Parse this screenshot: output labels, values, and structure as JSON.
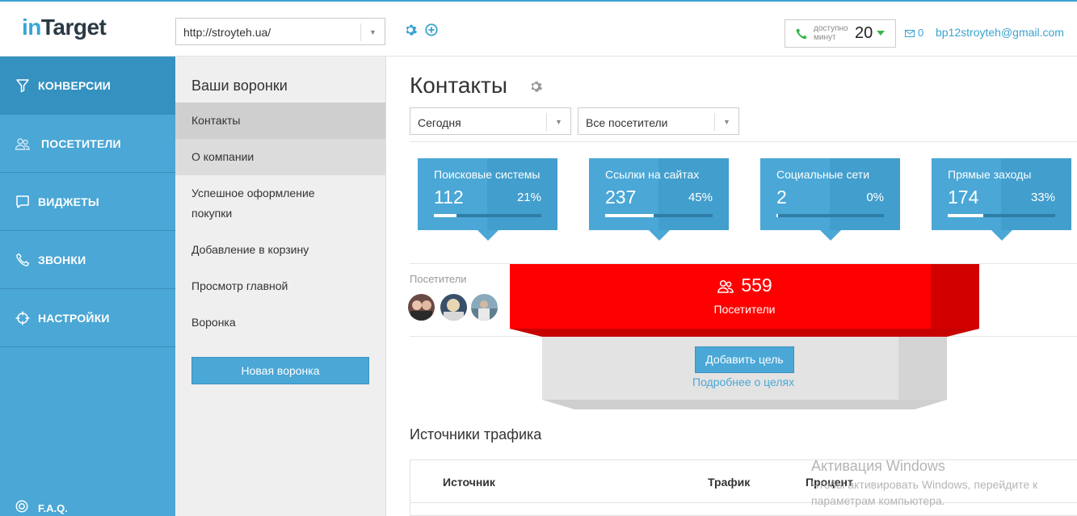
{
  "header": {
    "logo_prefix": "in",
    "logo_suffix": "Target",
    "site_select": "http://stroyteh.ua/",
    "minutes_label_line1": "доступно",
    "minutes_label_line2": "минут",
    "minutes_value": "20",
    "messages_count": "0",
    "email": "bp12stroyteh@gmail.com"
  },
  "sidebar": {
    "items": [
      {
        "label": "КОНВЕРСИИ",
        "icon": "filter-icon"
      },
      {
        "label": "ПОСЕТИТЕЛИ",
        "icon": "users-icon"
      },
      {
        "label": "ВИДЖЕТЫ",
        "icon": "widget-icon"
      },
      {
        "label": "ЗВОНКИ",
        "icon": "phone-icon"
      },
      {
        "label": "НАСТРОЙКИ",
        "icon": "crosshair-icon"
      }
    ],
    "faq": "F.A.Q."
  },
  "funnels": {
    "title": "Ваши воронки",
    "items": [
      "Контакты",
      "О компании",
      "Успешное оформление покупки",
      "Добавление в корзину",
      "Просмотр главной",
      "Воронка"
    ],
    "new_button": "Новая воронка"
  },
  "main": {
    "title": "Контакты",
    "period_select": "Сегодня",
    "visitors_select": "Все посетители",
    "cards": [
      {
        "name": "Поисковые системы",
        "value": "112",
        "percent": "21%",
        "fraction": 0.21
      },
      {
        "name": "Ссылки на сайтах",
        "value": "237",
        "percent": "45%",
        "fraction": 0.45
      },
      {
        "name": "Социальные сети",
        "value": "2",
        "percent": "0%",
        "fraction": 0.0
      },
      {
        "name": "Прямые заходы",
        "value": "174",
        "percent": "33%",
        "fraction": 0.33
      }
    ],
    "visitors_label": "Посетители",
    "funnel_count": "559",
    "funnel_label": "Посетители",
    "add_goal": "Добавить цель",
    "goal_link": "Подробнее о целях",
    "sources_title": "Источники трафика",
    "table_headers": [
      "Источник",
      "Трафик",
      "Процент"
    ]
  },
  "watermark": {
    "line1": "Активация Windows",
    "line2": "Чтобы активировать Windows, перейдите к",
    "line3": "параметрам компьютера."
  },
  "colors": {
    "accent": "#4aa7d6",
    "funnel_red": "#ff0000",
    "sidebar_active": "#3591c0"
  }
}
